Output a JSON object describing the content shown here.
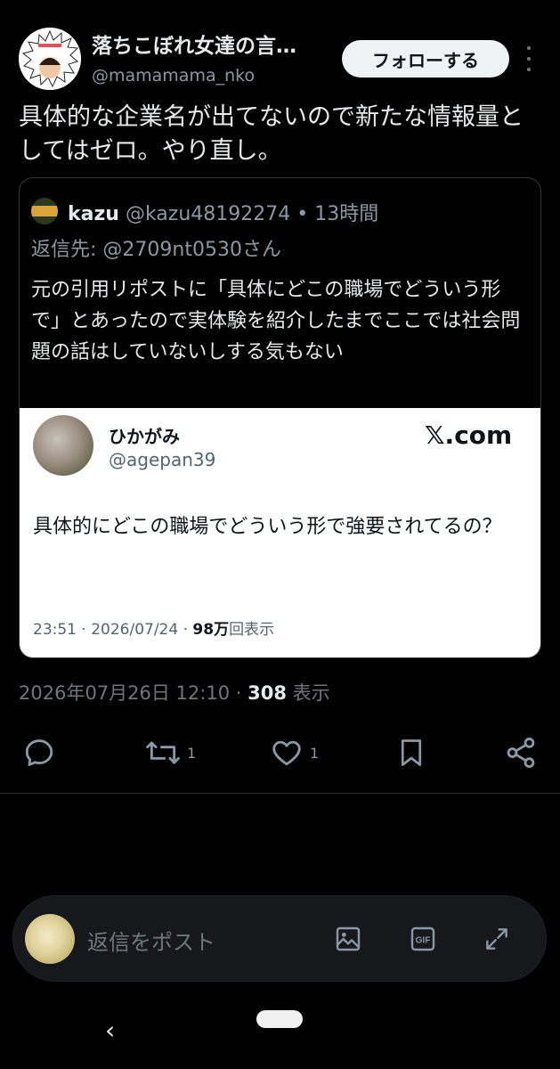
{
  "author": {
    "display_name": "落ちこぼれ女達の言…",
    "handle": "@mamamama_nko",
    "follow_label": "フォローする"
  },
  "post": {
    "text": "具体的な企業名が出てないので新たな情報量としてはゼロ。やり直し。",
    "timestamp": "2026年07月26日 12:10 · ",
    "views": "308",
    "views_label": " 表示"
  },
  "quote": {
    "name": "kazu",
    "meta": " @kazu48192274 • 13時間",
    "reply_to": "返信先: @2709nt0530さん",
    "text": "元の引用リポストに「具体にどこの職場でどういう形で」とあったので実体験を紹介したまでここでは社会問題の話はしていないしする気もない"
  },
  "embed": {
    "name": "ひかがみ",
    "handle": "@agepan39",
    "logo": "𝕏.com",
    "text": "具体的にどこの職場でどういう形で強要されてるの？",
    "meta_time": "23:51 · 2026/07/24 · ",
    "meta_views": "98万",
    "meta_views_label": "回表示"
  },
  "actions": {
    "reply_icon": "reply-icon",
    "retweet_icon": "retweet-icon",
    "retweet_count": "1",
    "like_icon": "heart-icon",
    "like_count": "1",
    "bookmark_icon": "bookmark-icon",
    "share_icon": "share-icon"
  },
  "composer": {
    "placeholder": "返信をポスト",
    "image_icon": "image-icon",
    "gif_label": "GIF",
    "expand_icon": "expand-icon"
  },
  "nav": {
    "back_glyph": "‹"
  },
  "colors": {
    "background": "#000000",
    "text_primary": "#e7e9ea",
    "text_secondary": "#71767b",
    "follow_button_bg": "#eff3f4",
    "border": "#333639"
  }
}
